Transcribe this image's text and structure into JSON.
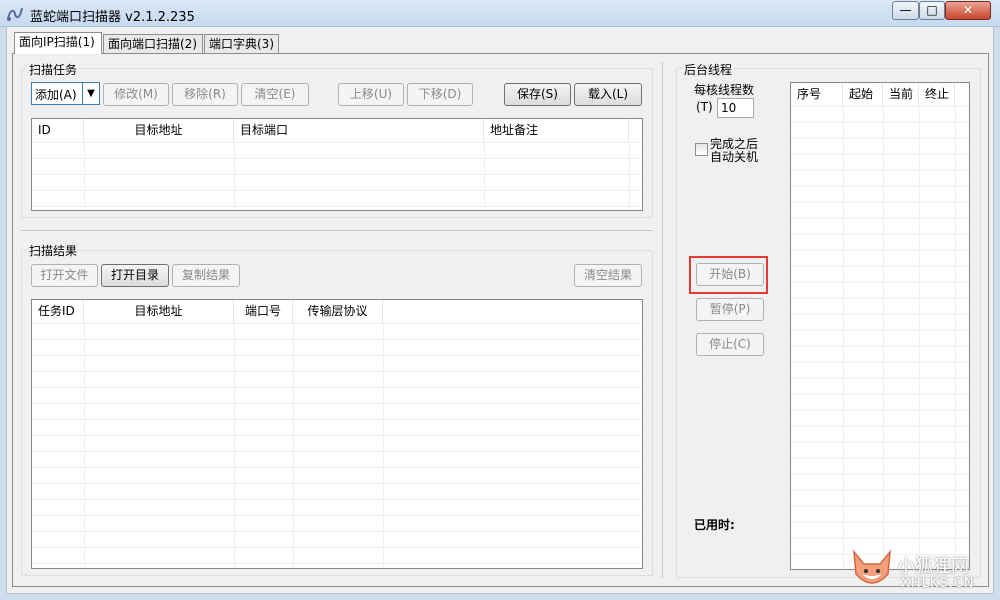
{
  "window": {
    "title": "蓝蛇端口扫描器 v2.1.2.235",
    "controls": {
      "minimize": "—",
      "maximize": "□",
      "close": "✕"
    }
  },
  "tabs": [
    {
      "label": "面向IP扫描(1)",
      "active": true
    },
    {
      "label": "面向端口扫描(2)",
      "active": false
    },
    {
      "label": "端口字典(3)",
      "active": false
    }
  ],
  "scan_task": {
    "title": "扫描任务",
    "add": "添加(A)",
    "edit": "修改(M)",
    "remove": "移除(R)",
    "clear": "清空(E)",
    "move_up": "上移(U)",
    "move_down": "下移(D)",
    "save": "保存(S)",
    "load": "载入(L)",
    "columns": [
      "ID",
      "目标地址",
      "目标端口",
      "地址备注"
    ]
  },
  "scan_result": {
    "title": "扫描结果",
    "open_file": "打开文件",
    "open_dir": "打开目录",
    "copy_result": "复制结果",
    "clear_result": "清空结果",
    "columns": [
      "任务ID",
      "目标地址",
      "端口号",
      "传输层协议"
    ]
  },
  "background_threads": {
    "title": "后台线程",
    "threads_label_1": "每核线程数",
    "threads_label_2": "(T)",
    "threads_value": "10",
    "shutdown_label_1": "完成之后",
    "shutdown_label_2": "自动关机",
    "shutdown_checked": false,
    "start": "开始(B)",
    "pause": "暂停(P)",
    "stop": "停止(C)",
    "elapsed_label": "已用时:",
    "columns": [
      "序号",
      "起始",
      "当前",
      "终止"
    ]
  },
  "watermark": {
    "text_cn": "小狐狸网",
    "text_en": "XHLKS.CN"
  },
  "colors": {
    "highlight": "#e53935",
    "titlebar": "#c6d9ef"
  }
}
